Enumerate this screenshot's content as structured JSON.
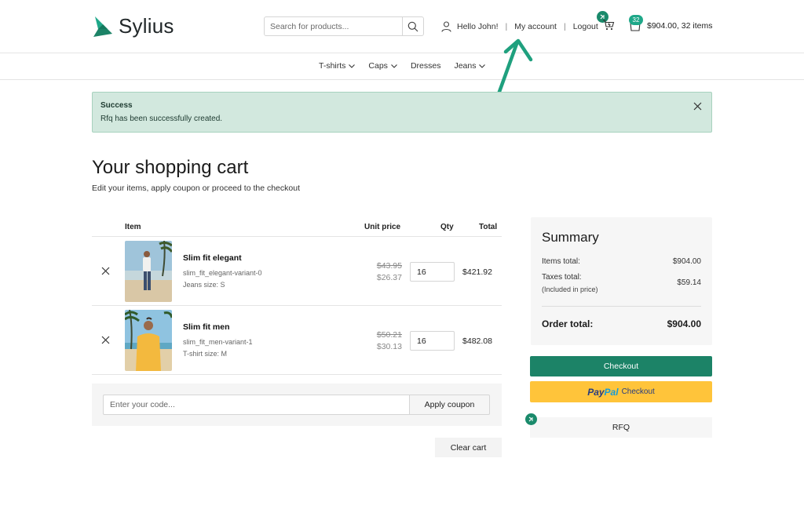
{
  "brand": {
    "name": "Sylius",
    "accent": "#1c8367"
  },
  "header": {
    "search_placeholder": "Search for products...",
    "greeting": "Hello John!",
    "sep1": "|",
    "my_account": "My account",
    "sep2": "|",
    "logout": "Logout",
    "cart_count": "32",
    "cart_summary": "$904.00, 32 items"
  },
  "menu": [
    {
      "label": "T-shirts",
      "dropdown": true
    },
    {
      "label": "Caps",
      "dropdown": true
    },
    {
      "label": "Dresses",
      "dropdown": false
    },
    {
      "label": "Jeans",
      "dropdown": true
    }
  ],
  "flash": {
    "title": "Success",
    "message": "Rfq has been successfully created."
  },
  "page": {
    "title": "Your shopping cart",
    "subtitle": "Edit your items, apply coupon or proceed to the checkout"
  },
  "table": {
    "headers": {
      "item": "Item",
      "unit_price": "Unit price",
      "qty": "Qty",
      "total": "Total"
    },
    "rows": [
      {
        "name": "Slim fit elegant",
        "code": "slim_fit_elegant-variant-0",
        "option": "Jeans size: S",
        "old_price": "$43.95",
        "price": "$26.37",
        "qty": "16",
        "total": "$421.92"
      },
      {
        "name": "Slim fit men",
        "code": "slim_fit_men-variant-1",
        "option": "T-shirt size: M",
        "old_price": "$50.21",
        "price": "$30.13",
        "qty": "16",
        "total": "$482.08"
      }
    ]
  },
  "coupon": {
    "placeholder": "Enter your code...",
    "apply": "Apply coupon"
  },
  "clear_cart": "Clear cart",
  "summary": {
    "title": "Summary",
    "items_total_label": "Items total:",
    "items_total": "$904.00",
    "taxes_label": "Taxes total:",
    "taxes_note": "(Included in price)",
    "taxes": "$59.14",
    "order_total_label": "Order total:",
    "order_total": "$904.00"
  },
  "buttons": {
    "checkout": "Checkout",
    "paypal_1": "Pay",
    "paypal_2": "Pal",
    "paypal_checkout": "Checkout",
    "rfq": "RFQ"
  }
}
